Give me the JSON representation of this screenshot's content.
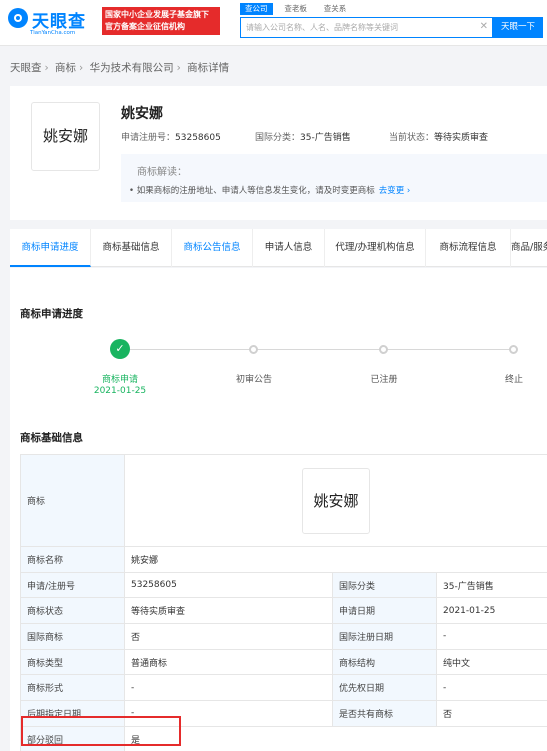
{
  "header": {
    "logo_text": "天眼查",
    "logo_sub": "TianYanCha.com",
    "gov_badge_line1": "国家中小企业发展子基金旗下",
    "gov_badge_line2": "官方备案企业征信机构",
    "search_tabs": [
      "查公司",
      "查老板",
      "查关系"
    ],
    "search_placeholder": "请输入公司名称、人名、品牌名称等关键词",
    "search_button": "天眼一下",
    "colors": {
      "brand": "#0084ff",
      "badge": "#e52b2b"
    }
  },
  "breadcrumb": [
    "天眼查",
    "商标",
    "华为技术有限公司",
    "商标详情"
  ],
  "top_card": {
    "thumb_text": "姚安娜",
    "name": "姚安娜",
    "reg_no_label": "申请注册号：",
    "reg_no": "53258605",
    "intl_class_label": "国际分类：",
    "intl_class": "35-广告销售",
    "status_label": "当前状态：",
    "status": "等待实质审查",
    "interp_title": "商标解读：",
    "interp_text": "• 如果商标的注册地址、申请人等信息发生变化，请及时变更商标",
    "interp_link": "去变更 ›"
  },
  "tabs": [
    "商标申请进度",
    "商标基础信息",
    "商标公告信息",
    "申请人信息",
    "代理/办理机构信息",
    "商标流程信息",
    "商品/服务"
  ],
  "progress": {
    "title": "商标申请进度",
    "steps": [
      {
        "label": "商标申请",
        "date": "2021-01-25",
        "done": true
      },
      {
        "label": "初审公告",
        "date": "",
        "done": false
      },
      {
        "label": "已注册",
        "date": "",
        "done": false
      },
      {
        "label": "终止",
        "date": "",
        "done": false
      }
    ],
    "done_color": "#19b460"
  },
  "basic_info": {
    "title": "商标基础信息",
    "trademark_label": "商标",
    "trademark_image_text": "姚安娜",
    "rows": [
      [
        "商标名称",
        "姚安娜",
        "",
        ""
      ],
      [
        "申请/注册号",
        "53258605",
        "国际分类",
        "35-广告销售"
      ],
      [
        "商标状态",
        "等待实质审查",
        "申请日期",
        "2021-01-25"
      ],
      [
        "国际商标",
        "否",
        "国际注册日期",
        "-"
      ],
      [
        "商标类型",
        "普通商标",
        "商标结构",
        "纯中文"
      ],
      [
        "商标形式",
        "-",
        "优先权日期",
        "-"
      ],
      [
        "后期指定日期",
        "-",
        "是否共有商标",
        "否"
      ],
      [
        "部分驳回",
        "是",
        "",
        ""
      ]
    ]
  }
}
